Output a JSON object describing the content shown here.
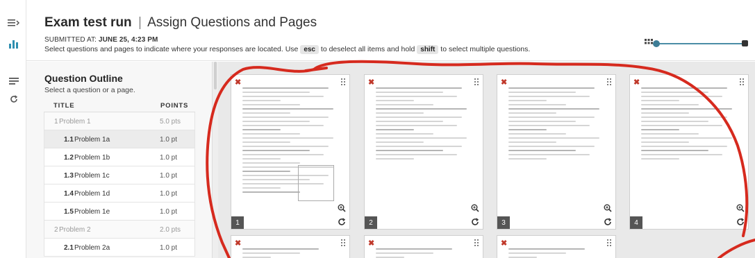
{
  "header": {
    "exam_name": "Exam test run",
    "separator": "|",
    "subtitle": "Assign Questions and Pages",
    "submitted_label": "Submitted at:",
    "submitted_value": "JUNE 25, 4:23 PM",
    "instructions_before": "Select questions and pages to indicate where your responses are located. Use",
    "key_esc": "esc",
    "instructions_middle": "to deselect all items and hold",
    "key_shift": "shift",
    "instructions_after": "to select multiple questions."
  },
  "outline": {
    "title": "Question Outline",
    "hint": "Select a question or a page.",
    "col_title": "TITLE",
    "col_points": "POINTS",
    "rows": [
      {
        "num": "1",
        "name": "Problem 1",
        "points": "5.0 pts",
        "kind": "group"
      },
      {
        "num": "1.1",
        "name": "Problem 1a",
        "points": "1.0 pt",
        "kind": "sub",
        "selected": true
      },
      {
        "num": "1.2",
        "name": "Problem 1b",
        "points": "1.0 pt",
        "kind": "sub"
      },
      {
        "num": "1.3",
        "name": "Problem 1c",
        "points": "1.0 pt",
        "kind": "sub"
      },
      {
        "num": "1.4",
        "name": "Problem 1d",
        "points": "1.0 pt",
        "kind": "sub"
      },
      {
        "num": "1.5",
        "name": "Problem 1e",
        "points": "1.0 pt",
        "kind": "sub"
      },
      {
        "num": "2",
        "name": "Problem 2",
        "points": "2.0 pts",
        "kind": "group"
      },
      {
        "num": "2.1",
        "name": "Problem 2a",
        "points": "1.0 pt",
        "kind": "sub"
      }
    ]
  },
  "pages": [
    {
      "number": "1"
    },
    {
      "number": "2"
    },
    {
      "number": "3"
    },
    {
      "number": "4"
    }
  ],
  "colors": {
    "accent": "#3d7d96",
    "delete": "#c0392b",
    "annotation": "#d62a1e"
  },
  "icons": {
    "rail_top": "menu-collapse-icon",
    "rail_chart": "bar-chart-icon",
    "rail_list": "list-icon",
    "rail_refresh": "refresh-icon",
    "zoom": "grid-icon"
  }
}
